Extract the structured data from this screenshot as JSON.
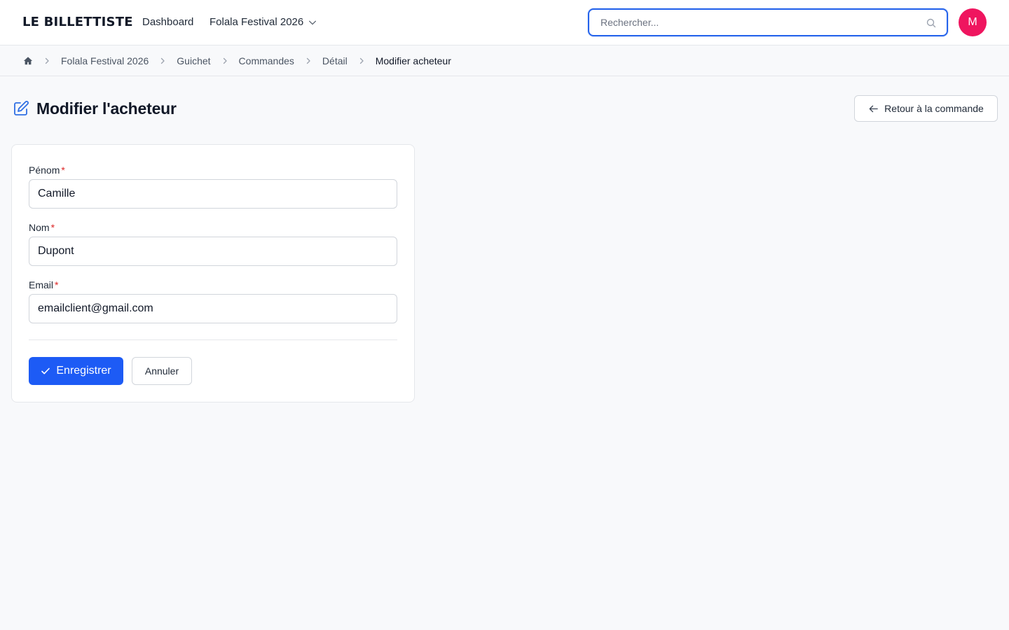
{
  "brand": {
    "name": "LE BILLETTISTE"
  },
  "nav": {
    "dashboard_label": "Dashboard",
    "event_label": "Folala Festival 2026",
    "event_icon": "chevron-down-icon"
  },
  "search": {
    "placeholder": "Rechercher...",
    "value": "",
    "icon": "search-icon"
  },
  "user": {
    "avatar_initial": "M",
    "avatar_color": "#ef155f"
  },
  "breadcrumb": {
    "home_icon": "home-icon",
    "items": [
      "Folala Festival 2026",
      "Guichet",
      "Commandes",
      "Détail"
    ],
    "current": "Modifier acheteur"
  },
  "header": {
    "title": "Modifier l'acheteur",
    "title_icon": "edit-icon",
    "back_label": "Retour à la commande",
    "back_icon": "arrow-left-icon"
  },
  "form": {
    "required_marker": "*",
    "fields": [
      {
        "label": "Pénom",
        "value": "Camille"
      },
      {
        "label": "Nom",
        "value": "Dupont"
      },
      {
        "label": "Email",
        "value": "emailclient@gmail.com"
      }
    ],
    "save_label": "Enregistrer",
    "save_icon": "check-icon",
    "cancel_label": "Annuler"
  },
  "colors": {
    "primary": "#1d5bf5",
    "focus_border": "#2563eb",
    "required": "#dc2626",
    "background": "#f8f9fb"
  }
}
